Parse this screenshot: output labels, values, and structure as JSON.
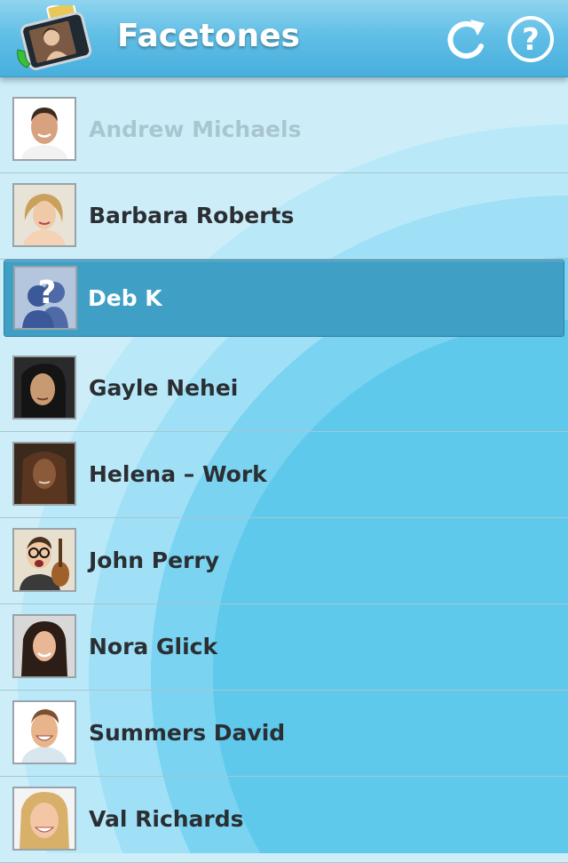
{
  "header": {
    "title": "Facetones",
    "refresh_icon": "refresh-icon",
    "help_icon": "help-icon"
  },
  "contacts": [
    {
      "name": "Andrew Michaels",
      "dimmed": true
    },
    {
      "name": "Barbara Roberts"
    },
    {
      "name": "Deb K",
      "selected": true,
      "placeholder_avatar": true
    },
    {
      "name": "Gayle Nehei"
    },
    {
      "name": "Helena – Work"
    },
    {
      "name": "John Perry"
    },
    {
      "name": "Nora Glick"
    },
    {
      "name": "Summers David"
    },
    {
      "name": "Val Richards"
    }
  ],
  "colors": {
    "header": "#47afdd",
    "selected_row": "#3f9fc5",
    "background": "#cdeef9",
    "name_text": "#2b2f33",
    "dimmed_text": "#a9c6cf"
  }
}
